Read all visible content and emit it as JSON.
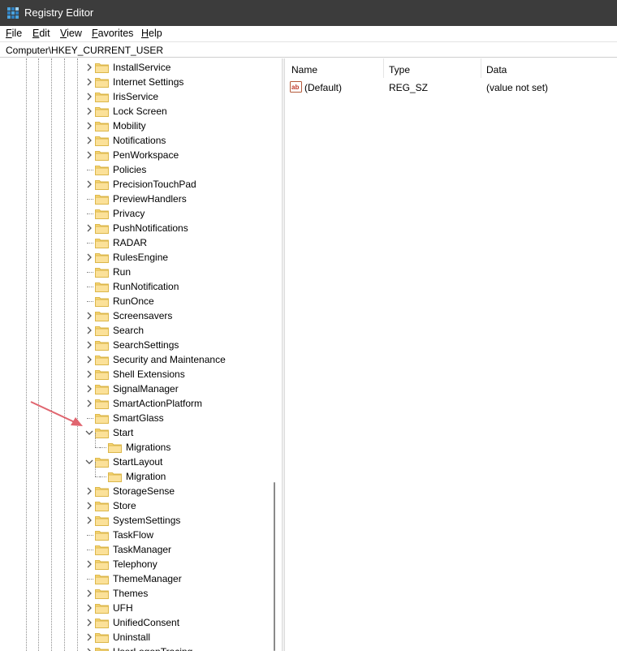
{
  "window": {
    "title": "Registry Editor"
  },
  "menu": [
    {
      "label": "File",
      "u": "F",
      "rest": "ile"
    },
    {
      "label": "Edit",
      "u": "E",
      "rest": "dit"
    },
    {
      "label": "View",
      "u": "V",
      "rest": "iew"
    },
    {
      "label": "Favorites",
      "u": "F",
      "rest": "avorites"
    },
    {
      "label": "Help",
      "u": "H",
      "rest": "elp"
    }
  ],
  "address": "Computer\\HKEY_CURRENT_USER",
  "tree": [
    {
      "label": "InstallService",
      "expander": "collapsed",
      "level": 0
    },
    {
      "label": "Internet Settings",
      "expander": "collapsed",
      "level": 0
    },
    {
      "label": "IrisService",
      "expander": "collapsed",
      "level": 0
    },
    {
      "label": "Lock Screen",
      "expander": "collapsed",
      "level": 0
    },
    {
      "label": "Mobility",
      "expander": "collapsed",
      "level": 0
    },
    {
      "label": "Notifications",
      "expander": "collapsed",
      "level": 0
    },
    {
      "label": "PenWorkspace",
      "expander": "collapsed",
      "level": 0
    },
    {
      "label": "Policies",
      "expander": "none",
      "level": 0
    },
    {
      "label": "PrecisionTouchPad",
      "expander": "collapsed",
      "level": 0
    },
    {
      "label": "PreviewHandlers",
      "expander": "none",
      "level": 0
    },
    {
      "label": "Privacy",
      "expander": "none",
      "level": 0
    },
    {
      "label": "PushNotifications",
      "expander": "collapsed",
      "level": 0
    },
    {
      "label": "RADAR",
      "expander": "none",
      "level": 0
    },
    {
      "label": "RulesEngine",
      "expander": "collapsed",
      "level": 0
    },
    {
      "label": "Run",
      "expander": "none",
      "level": 0
    },
    {
      "label": "RunNotification",
      "expander": "none",
      "level": 0
    },
    {
      "label": "RunOnce",
      "expander": "none",
      "level": 0
    },
    {
      "label": "Screensavers",
      "expander": "collapsed",
      "level": 0
    },
    {
      "label": "Search",
      "expander": "collapsed",
      "level": 0
    },
    {
      "label": "SearchSettings",
      "expander": "collapsed",
      "level": 0
    },
    {
      "label": "Security and Maintenance",
      "expander": "collapsed",
      "level": 0
    },
    {
      "label": "Shell Extensions",
      "expander": "collapsed",
      "level": 0
    },
    {
      "label": "SignalManager",
      "expander": "collapsed",
      "level": 0
    },
    {
      "label": "SmartActionPlatform",
      "expander": "collapsed",
      "level": 0
    },
    {
      "label": "SmartGlass",
      "expander": "none",
      "level": 0
    },
    {
      "label": "Start",
      "expander": "expanded",
      "level": 0
    },
    {
      "label": "Migrations",
      "expander": "none",
      "level": 1
    },
    {
      "label": "StartLayout",
      "expander": "expanded",
      "level": 0
    },
    {
      "label": "Migration",
      "expander": "none",
      "level": 1
    },
    {
      "label": "StorageSense",
      "expander": "collapsed",
      "level": 0
    },
    {
      "label": "Store",
      "expander": "collapsed",
      "level": 0
    },
    {
      "label": "SystemSettings",
      "expander": "collapsed",
      "level": 0
    },
    {
      "label": "TaskFlow",
      "expander": "none",
      "level": 0
    },
    {
      "label": "TaskManager",
      "expander": "none",
      "level": 0
    },
    {
      "label": "Telephony",
      "expander": "collapsed",
      "level": 0
    },
    {
      "label": "ThemeManager",
      "expander": "none",
      "level": 0
    },
    {
      "label": "Themes",
      "expander": "collapsed",
      "level": 0
    },
    {
      "label": "UFH",
      "expander": "collapsed",
      "level": 0
    },
    {
      "label": "UnifiedConsent",
      "expander": "collapsed",
      "level": 0
    },
    {
      "label": "Uninstall",
      "expander": "collapsed",
      "level": 0
    },
    {
      "label": "UserLogonTracing",
      "expander": "collapsed",
      "level": 0
    }
  ],
  "columns": {
    "name": "Name",
    "type": "Type",
    "data": "Data"
  },
  "values": [
    {
      "name": "(Default)",
      "type": "REG_SZ",
      "data": "(value not set)",
      "icon": "string-value-icon"
    }
  ],
  "colors": {
    "titlebar": "#3c3c3c",
    "folder": "#f8d775",
    "folder_edge": "#dcb74a",
    "arrow": "#e0656f"
  }
}
